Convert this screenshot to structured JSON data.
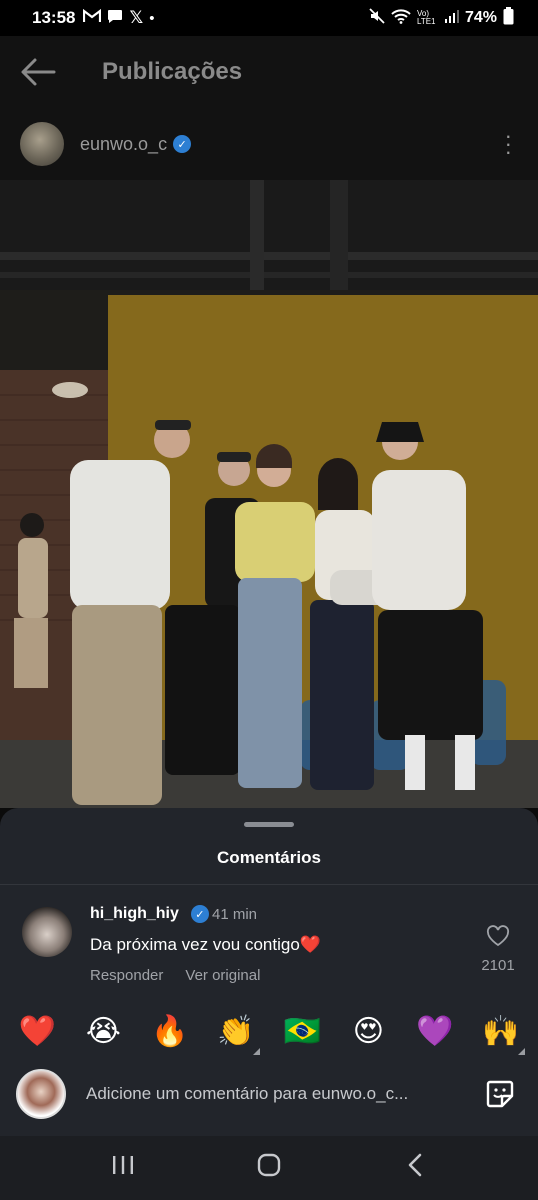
{
  "status_bar": {
    "time": "13:58",
    "notifications": [
      "gmail-icon",
      "messages-icon",
      "x-icon",
      "dot-icon"
    ],
    "network": "Vo) LTE1",
    "battery": "74%"
  },
  "header": {
    "title": "Publicações"
  },
  "post": {
    "username": "eunwo.o_c",
    "verified": true
  },
  "comments_sheet": {
    "title": "Comentários",
    "comment": {
      "username": "hi_high_hiy",
      "verified": true,
      "time": "41 min",
      "text": "Da próxima vez vou contigo❤️",
      "reply_label": "Responder",
      "see_original_label": "Ver original",
      "likes": "2101"
    },
    "quick_emojis": [
      "❤️",
      "😭",
      "🔥",
      "👏",
      "🇧🇷",
      "😍",
      "💜",
      "🙌"
    ],
    "input_placeholder": "Adicione um comentário para eunwo.o_c..."
  },
  "colors": {
    "accent_verified": "#2d7fd3",
    "sheet_bg": "#22252b",
    "heart_red": "#e0245e"
  }
}
